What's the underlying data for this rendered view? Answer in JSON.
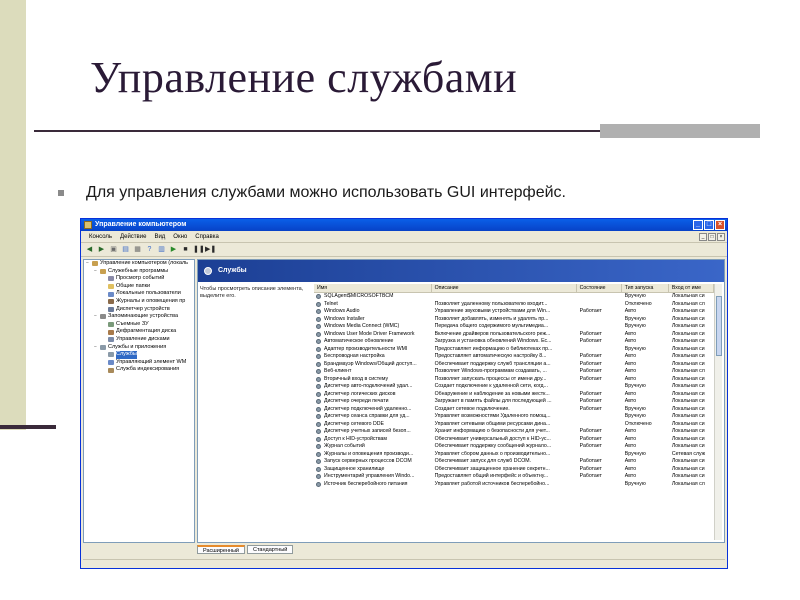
{
  "slide": {
    "title": "Управление службами",
    "bullet": "Для управления службами можно использовать GUI интерфейс."
  },
  "window": {
    "title": "Управление компьютером",
    "menu": [
      "Консоль",
      "Действие",
      "Вид",
      "Окно",
      "Справка"
    ]
  },
  "tree": [
    {
      "label": "Управление компьютером (локаль",
      "indent": 0,
      "color": "#c8a050"
    },
    {
      "label": "Служебные программы",
      "indent": 1,
      "color": "#c8a050"
    },
    {
      "label": "Просмотр событий",
      "indent": 2,
      "color": "#8a8aa8"
    },
    {
      "label": "Общие папки",
      "indent": 2,
      "color": "#e0c060"
    },
    {
      "label": "Локальные пользователи",
      "indent": 2,
      "color": "#6a8ac8"
    },
    {
      "label": "Журналы и оповещения пр",
      "indent": 2,
      "color": "#8a6a4a"
    },
    {
      "label": "Диспетчер устройств",
      "indent": 2,
      "color": "#6a7a9a"
    },
    {
      "label": "Запоминающие устройства",
      "indent": 1,
      "color": "#8a8a8a"
    },
    {
      "label": "Съемные ЗУ",
      "indent": 2,
      "color": "#7a9a7a"
    },
    {
      "label": "Дефрагментация диска",
      "indent": 2,
      "color": "#a87a4a"
    },
    {
      "label": "Управление дисками",
      "indent": 2,
      "color": "#7a8aa8"
    },
    {
      "label": "Службы и приложения",
      "indent": 1,
      "color": "#8a9aa8"
    },
    {
      "label": "Службы",
      "indent": 2,
      "color": "#8a9aa8",
      "selected": true
    },
    {
      "label": "Управляющий элемент WM",
      "indent": 2,
      "color": "#6a8ac8"
    },
    {
      "label": "Служба индексирования",
      "indent": 2,
      "color": "#a88a5a"
    }
  ],
  "panel": {
    "header": "Службы",
    "description": "Чтобы просмотреть описание элемента, выделите его."
  },
  "columns": [
    "Имя",
    "Описание",
    "Состояние",
    "Тип запуска",
    "Вход от име"
  ],
  "services": [
    [
      "SQLAgent$MICROSOFTBCM",
      "",
      "",
      "Вручную",
      "Локальная си"
    ],
    [
      "Telnet",
      "Позволяет удаленному пользователю входит...",
      "",
      "Отключено",
      "Локальная сл"
    ],
    [
      "Windows Audio",
      "Управление звуковыми устройствами для Win...",
      "Работает",
      "Авто",
      "Локальная си"
    ],
    [
      "Windows Installer",
      "Позволяет добавлять, изменять и удалять пр...",
      "",
      "Вручную",
      "Локальная си"
    ],
    [
      "Windows Media Connect (WMC)",
      "Передача общего содержимого мультимедиа...",
      "",
      "Вручную",
      "Локальная си"
    ],
    [
      "Windows User Mode Driver Framework",
      "Включение драйверов пользовательского реж...",
      "Работает",
      "Авто",
      "Локальная си"
    ],
    [
      "Автоматическое обновление",
      "Загрузка и установка обновлений Windows. Ес...",
      "Работает",
      "Авто",
      "Локальная си"
    ],
    [
      "Адаптер производительности WMI",
      "Предоставляет информацию о библиотеках пр...",
      "",
      "Вручную",
      "Локальная си"
    ],
    [
      "Беспроводная настройка",
      "Предоставляет автоматическую настройку 8...",
      "Работает",
      "Авто",
      "Локальная си"
    ],
    [
      "Брандмауэр Windows/Общий доступ...",
      "Обеспечивает поддержку служб трансляции а...",
      "Работает",
      "Авто",
      "Локальная си"
    ],
    [
      "Веб-клиент",
      "Позволяет Windows-программам создавать, ...",
      "Работает",
      "Авто",
      "Локальная сл"
    ],
    [
      "Вторичный вход в систему",
      "Позволяет запускать процессы от имени дру...",
      "Работает",
      "Авто",
      "Локальная си"
    ],
    [
      "Диспетчер авто-подключений удал...",
      "Создает подключение к удаленной сети, когд...",
      "",
      "Вручную",
      "Локальная си"
    ],
    [
      "Диспетчер логических дисков",
      "Обнаружение и наблюдение за новыми жестк...",
      "Работает",
      "Авто",
      "Локальная си"
    ],
    [
      "Диспетчер очереди печати",
      "Загружает в память файлы для последующей ...",
      "Работает",
      "Авто",
      "Локальная си"
    ],
    [
      "Диспетчер подключений удаленно...",
      "Создает сетевое подключение.",
      "Работает",
      "Вручную",
      "Локальная си"
    ],
    [
      "Диспетчер сеанса справки для уд...",
      "Управляет возможностями Удаленного помощ...",
      "",
      "Вручную",
      "Локальная си"
    ],
    [
      "Диспетчер сетевого DDE",
      "Управляет сетевыми общими ресурсами дина...",
      "",
      "Отключено",
      "Локальная си"
    ],
    [
      "Диспетчер учетных записей безоп...",
      "Хранит информацию о безопасности для учет...",
      "Работает",
      "Авто",
      "Локальная си"
    ],
    [
      "Доступ к HID-устройствам",
      "Обеспечивает универсальный доступ к HID-ус...",
      "Работает",
      "Авто",
      "Локальная си"
    ],
    [
      "Журнал событий",
      "Обеспечивает поддержку сообщений журнало...",
      "Работает",
      "Авто",
      "Локальная си"
    ],
    [
      "Журналы и оповещения производи...",
      "Управляет сбором данных о производительно...",
      "",
      "Вручную",
      "Сетевая служ"
    ],
    [
      "Запуск серверных процессов DCOM",
      "Обеспечивает запуск для служб DCOM.",
      "Работает",
      "Авто",
      "Локальная си"
    ],
    [
      "Защищенное хранилище",
      "Обеспечивает защищенное хранение секретн...",
      "Работает",
      "Авто",
      "Локальная си"
    ],
    [
      "Инструментарий управления Windo...",
      "Предоставляет общий интерфейс и объектну...",
      "Работает",
      "Авто",
      "Локальная си"
    ],
    [
      "Источник бесперебойного питания",
      "Управляет работой источников бесперебойно...",
      "",
      "Вручную",
      "Локальная сл"
    ]
  ],
  "tabs": [
    "Расширенный",
    "Стандартный"
  ]
}
